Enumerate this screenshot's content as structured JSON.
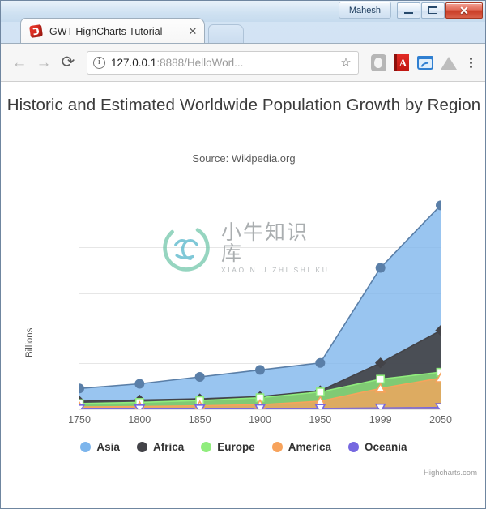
{
  "window": {
    "user_button": "Mahesh",
    "minimize_label": "—",
    "maximize_label": "□",
    "close_label": "✕"
  },
  "browser": {
    "tab": {
      "title": "GWT HighCharts Tutorial",
      "close_label": "✕",
      "favicon_name": "gwt-favicon"
    },
    "toolbar": {
      "back_label": "←",
      "forward_label": "→",
      "reload_label": "⟳",
      "info_label": "i",
      "url_host": "127.0.0.1",
      "url_path": ":8888/HelloWorl...",
      "star_label": "☆",
      "extensions": [
        "shield-icon",
        "red-book-icon",
        "photo-frame-icon",
        "drive-icon"
      ],
      "menu_label": "⋮"
    }
  },
  "chart_data": {
    "type": "area",
    "title": "Historic and Estimated Worldwide Population Growth by Region",
    "subtitle": "Source: Wikipedia.org",
    "xlabel": "",
    "ylabel": "Billions",
    "categories": [
      "1750",
      "1800",
      "1850",
      "1900",
      "1950",
      "1999",
      "2050"
    ],
    "yticks": [
      0,
      2,
      5,
      7,
      10
    ],
    "ylim": [
      0,
      10
    ],
    "grid": true,
    "stacked": false,
    "legend_position": "bottom",
    "credit": "Highcharts.com",
    "series": [
      {
        "name": "Asia",
        "color": "#7cb5ec",
        "marker": "circle",
        "values": [
          0.9,
          1.1,
          1.4,
          1.7,
          2.0,
          6.1,
          8.8
        ]
      },
      {
        "name": "Africa",
        "color": "#434348",
        "marker": "diamond",
        "values": [
          0.35,
          0.4,
          0.45,
          0.55,
          0.8,
          2.0,
          3.4
        ]
      },
      {
        "name": "Europe",
        "color": "#90ed7d",
        "marker": "square",
        "values": [
          0.25,
          0.3,
          0.38,
          0.5,
          0.75,
          1.3,
          1.6
        ]
      },
      {
        "name": "America",
        "color": "#f7a35c",
        "marker": "triangle",
        "values": [
          0.1,
          0.12,
          0.15,
          0.2,
          0.35,
          0.9,
          1.35
        ]
      },
      {
        "name": "Oceania",
        "color": "#7668e0",
        "marker": "triangle-down",
        "values": [
          0.02,
          0.02,
          0.02,
          0.03,
          0.04,
          0.06,
          0.08
        ]
      }
    ]
  },
  "watermark": {
    "cn_text": "小牛知识库",
    "en_text": "XIAO NIU ZHI SHI KU"
  }
}
